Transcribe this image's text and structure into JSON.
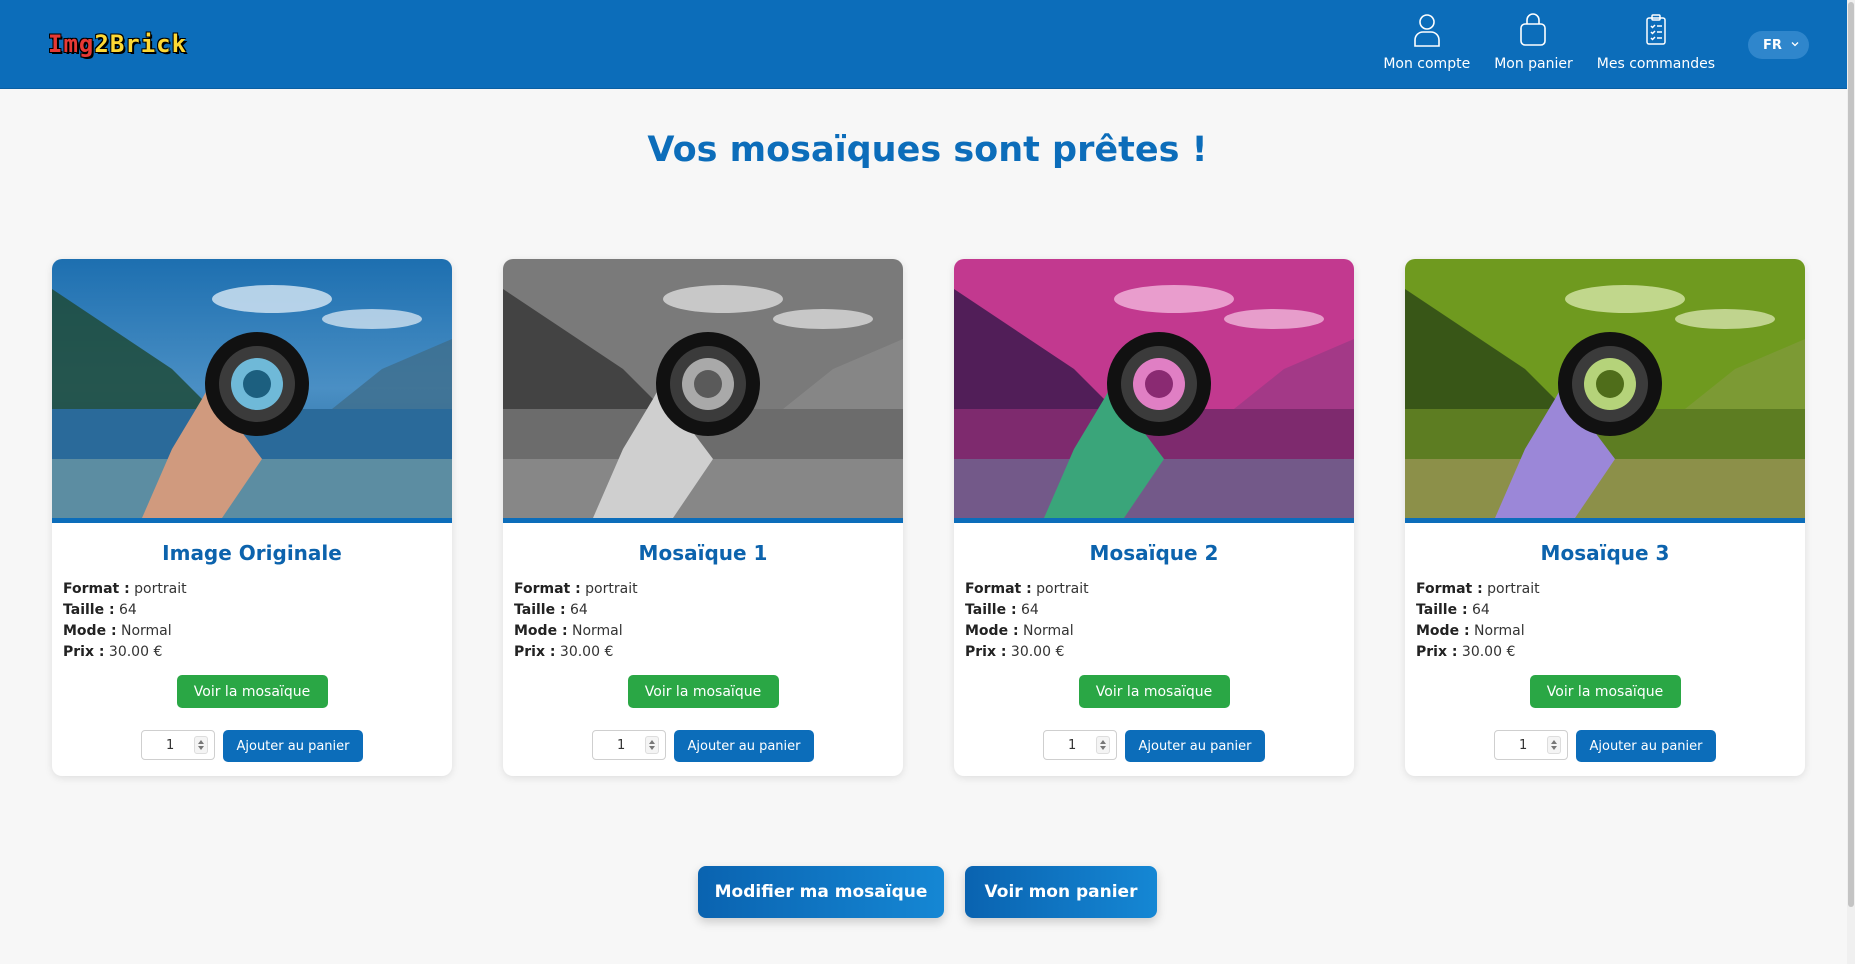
{
  "header": {
    "logo_text_1": "Img",
    "logo_text_2": "2",
    "logo_text_3": "Brick",
    "nav": [
      {
        "label": "Mon compte",
        "icon": "user-icon"
      },
      {
        "label": "Mon panier",
        "icon": "shopping-bag-icon"
      },
      {
        "label": "Mes commandes",
        "icon": "clipboard-list-icon"
      }
    ],
    "language": "FR"
  },
  "page_title": "Vos mosaïques sont prêtes !",
  "labels": {
    "format": "Format :",
    "size": "Taille :",
    "mode": "Mode :",
    "price": "Prix :",
    "view_button": "Voir la mosaïque",
    "add_button": "Ajouter au panier"
  },
  "cards": [
    {
      "title": "Image Originale",
      "format": "portrait",
      "size": "64",
      "mode": "Normal",
      "price": "30.00 €",
      "quantity": "1",
      "tint": "original"
    },
    {
      "title": "Mosaïque 1",
      "format": "portrait",
      "size": "64",
      "mode": "Normal",
      "price": "30.00 €",
      "quantity": "1",
      "tint": "grayscale"
    },
    {
      "title": "Mosaïque 2",
      "format": "portrait",
      "size": "64",
      "mode": "Normal",
      "price": "30.00 €",
      "quantity": "1",
      "tint": "magenta"
    },
    {
      "title": "Mosaïque 3",
      "format": "portrait",
      "size": "64",
      "mode": "Normal",
      "price": "30.00 €",
      "quantity": "1",
      "tint": "green"
    }
  ],
  "actions": {
    "modify": "Modifier ma mosaïque",
    "view_cart": "Voir mon panier"
  },
  "colors": {
    "primary": "#0c6dba",
    "success": "#2aa745",
    "background": "#f7f7f7"
  }
}
